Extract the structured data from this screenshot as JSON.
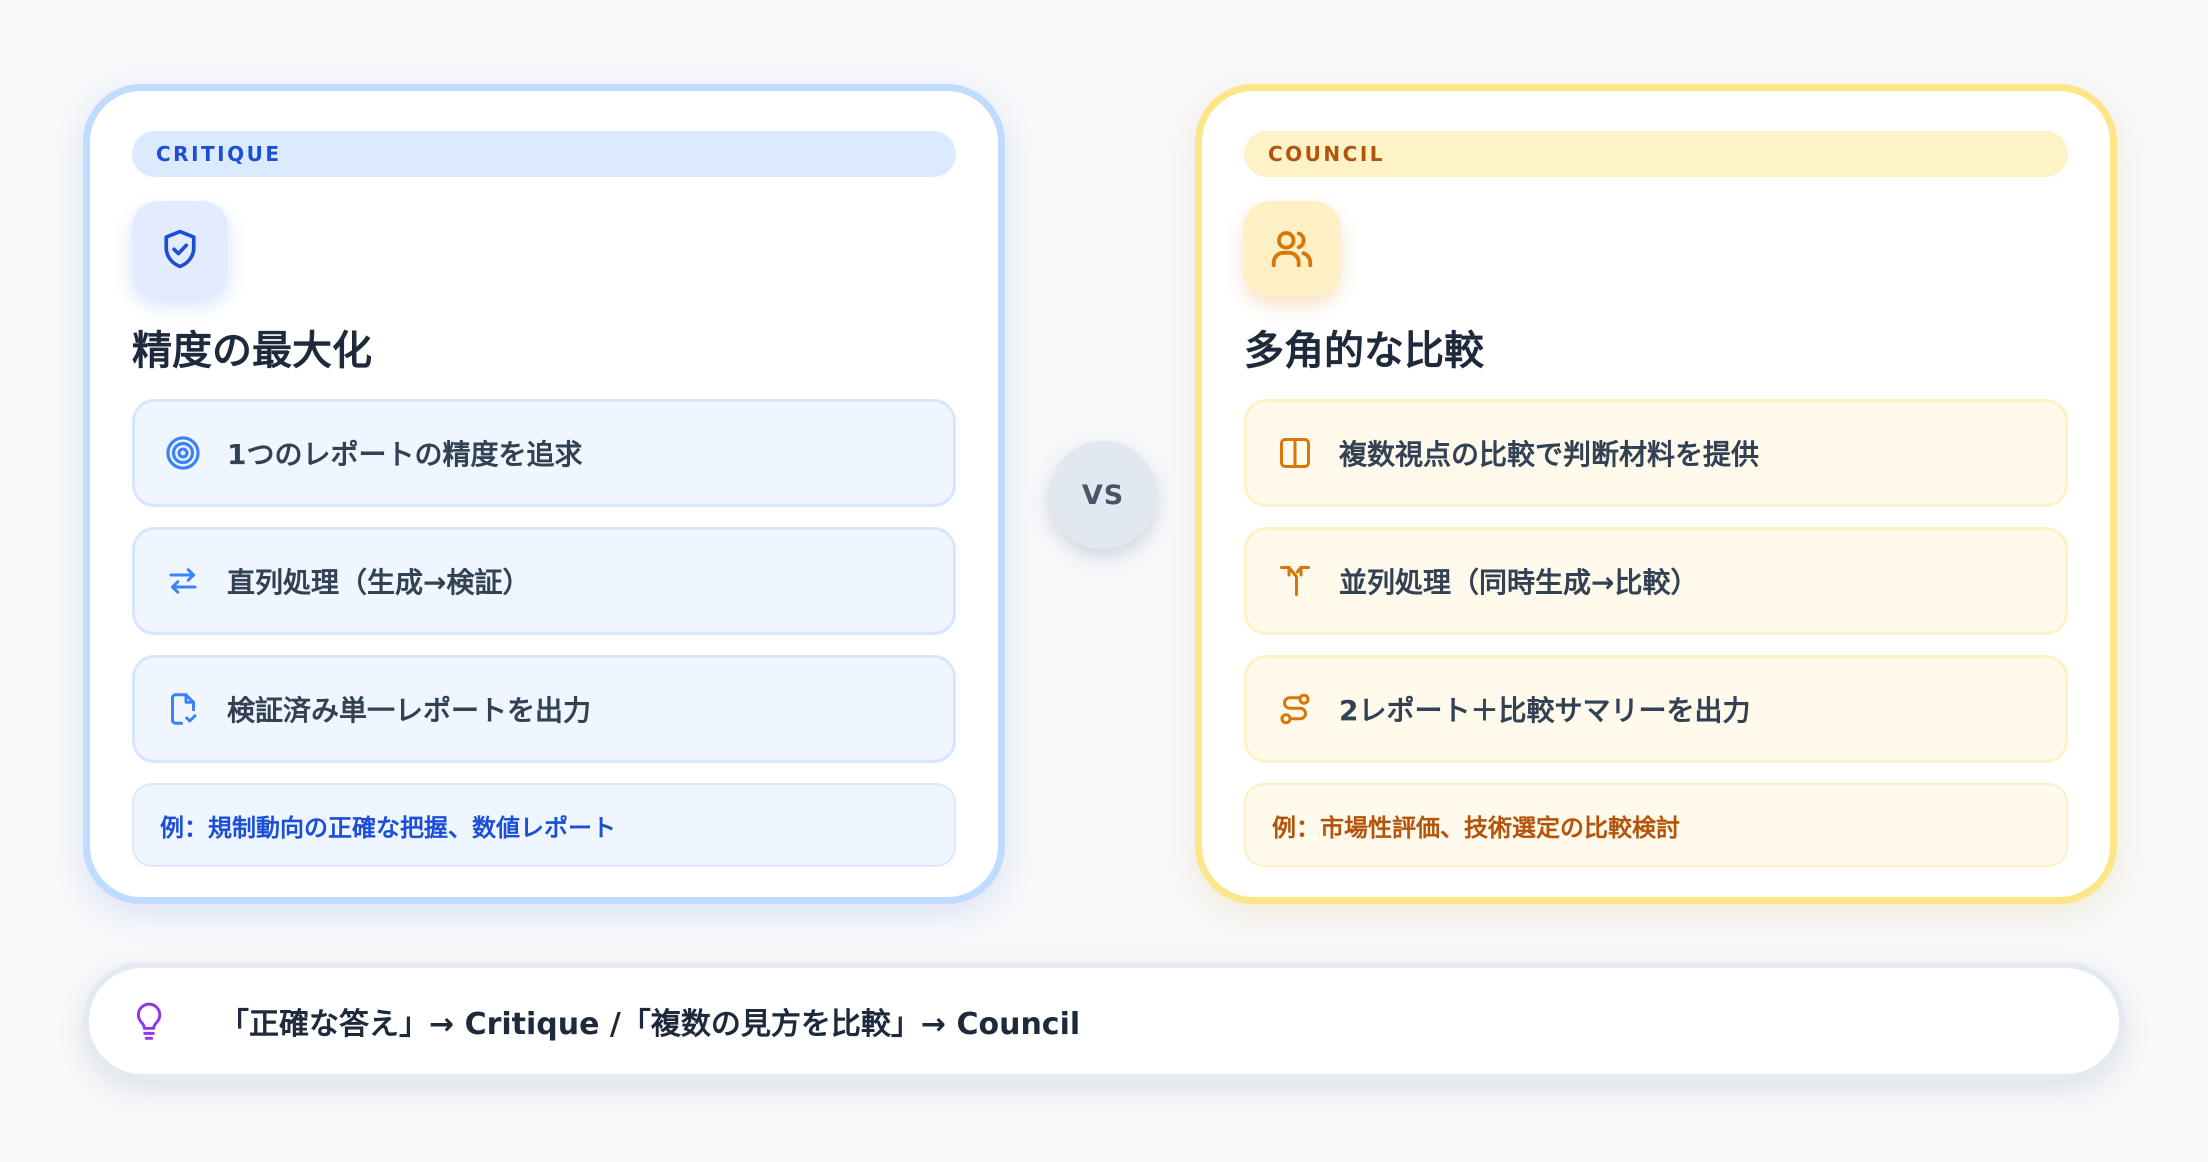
{
  "critique": {
    "label": "CRITIQUE",
    "icon": "shield-check-icon",
    "title": "精度の最大化",
    "items": [
      {
        "icon": "target-icon",
        "text": "1つのレポートの精度を追求"
      },
      {
        "icon": "swap-arrows-icon",
        "text": "直列処理（生成→検証）"
      },
      {
        "icon": "file-check-icon",
        "text": "検証済み単一レポートを出力"
      }
    ],
    "example": "例：規制動向の正確な把握、数値レポート",
    "colors": {
      "accent": "#1d4ed8",
      "border": "#bfdbfe",
      "fill": "#eff6ff"
    }
  },
  "vs_label": "VS",
  "council": {
    "label": "COUNCIL",
    "icon": "users-icon",
    "title": "多角的な比較",
    "items": [
      {
        "icon": "columns-icon",
        "text": "複数視点の比較で判断材料を提供"
      },
      {
        "icon": "split-arrows-icon",
        "text": "並列処理（同時生成→比較）"
      },
      {
        "icon": "route-icon",
        "text": "2レポート＋比較サマリーを出力"
      }
    ],
    "example": "例：市場性評価、技術選定の比較検討",
    "colors": {
      "accent": "#b45309",
      "border": "#fde68a",
      "fill": "#fffaeb"
    }
  },
  "tip": {
    "icon": "lightbulb-icon",
    "text": "「正確な答え」→ Critique /「複数の見方を比較」→ Council",
    "color": "#9333ea"
  }
}
